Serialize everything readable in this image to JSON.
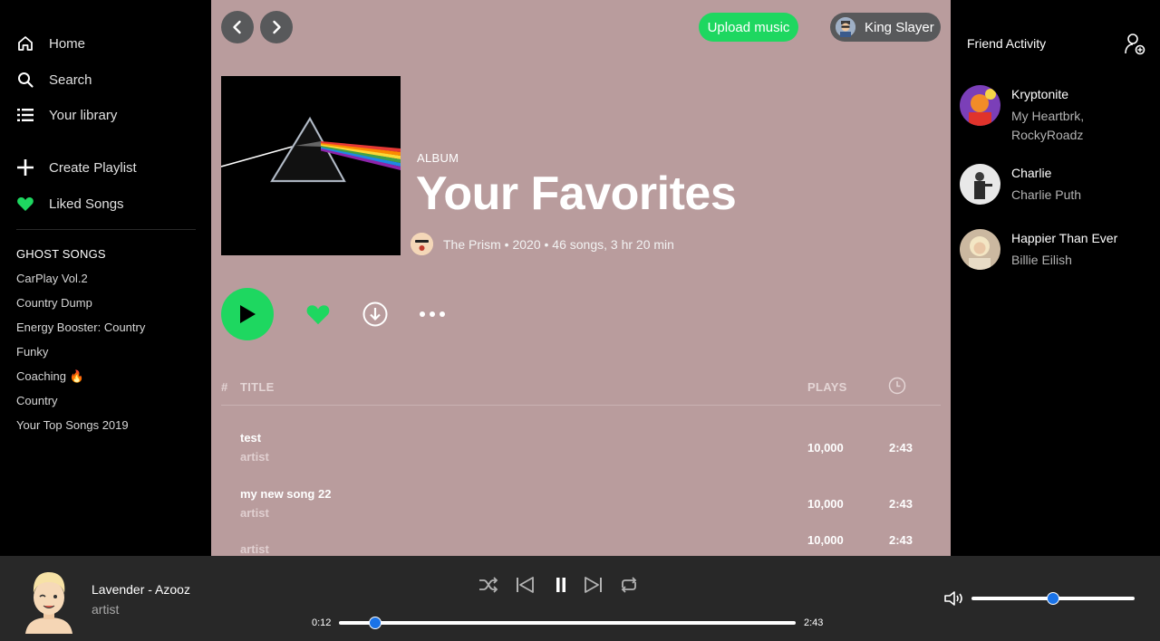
{
  "sidebar": {
    "nav": [
      {
        "label": "Home",
        "icon": "home-icon"
      },
      {
        "label": "Search",
        "icon": "search-icon"
      },
      {
        "label": "Your library",
        "icon": "list-icon"
      }
    ],
    "actions": [
      {
        "label": "Create Playlist",
        "icon": "plus-icon"
      },
      {
        "label": "Liked Songs",
        "icon": "heart-icon"
      }
    ],
    "section_title": "GHOST SONGS",
    "playlists": [
      "CarPlay Vol.2",
      "Country Dump",
      "Energy Booster: Country",
      "Funky",
      "Coaching 🔥",
      "Country",
      "Your Top Songs 2019"
    ]
  },
  "header": {
    "upload_label": "Upload music",
    "user_name": "King Slayer"
  },
  "album": {
    "type_label": "ALBUM",
    "title": "Your Favorites",
    "meta": "The Prism • 2020 • 46 songs, 3 hr 20 min"
  },
  "table": {
    "col_num": "#",
    "col_title": "TITLE",
    "col_plays": "PLAYS",
    "rows": [
      {
        "title": "test",
        "artist": "artist",
        "plays": "10,000",
        "duration": "2:43"
      },
      {
        "title": "my new song 22",
        "artist": "artist",
        "plays": "10,000",
        "duration": "2:43"
      },
      {
        "title": "",
        "artist": "artist",
        "plays": "10,000",
        "duration": "2:43"
      }
    ]
  },
  "friends": {
    "title": "Friend Activity",
    "items": [
      {
        "name": "Kryptonite",
        "song": "My Heartbrk, RockyRoadz"
      },
      {
        "name": "Charlie",
        "song": "Charlie Puth"
      },
      {
        "name": "Happier Than Ever",
        "song": "Billie Eilish"
      }
    ]
  },
  "player": {
    "title": "Lavender - Azooz",
    "artist": "artist",
    "elapsed": "0:12",
    "total": "2:43",
    "progress": 0.08,
    "volume": 0.5
  },
  "colors": {
    "accent": "#1ed760",
    "main_bg": "#b99c9d",
    "player_bg": "#282828",
    "slider_knob": "#1a73e8"
  }
}
